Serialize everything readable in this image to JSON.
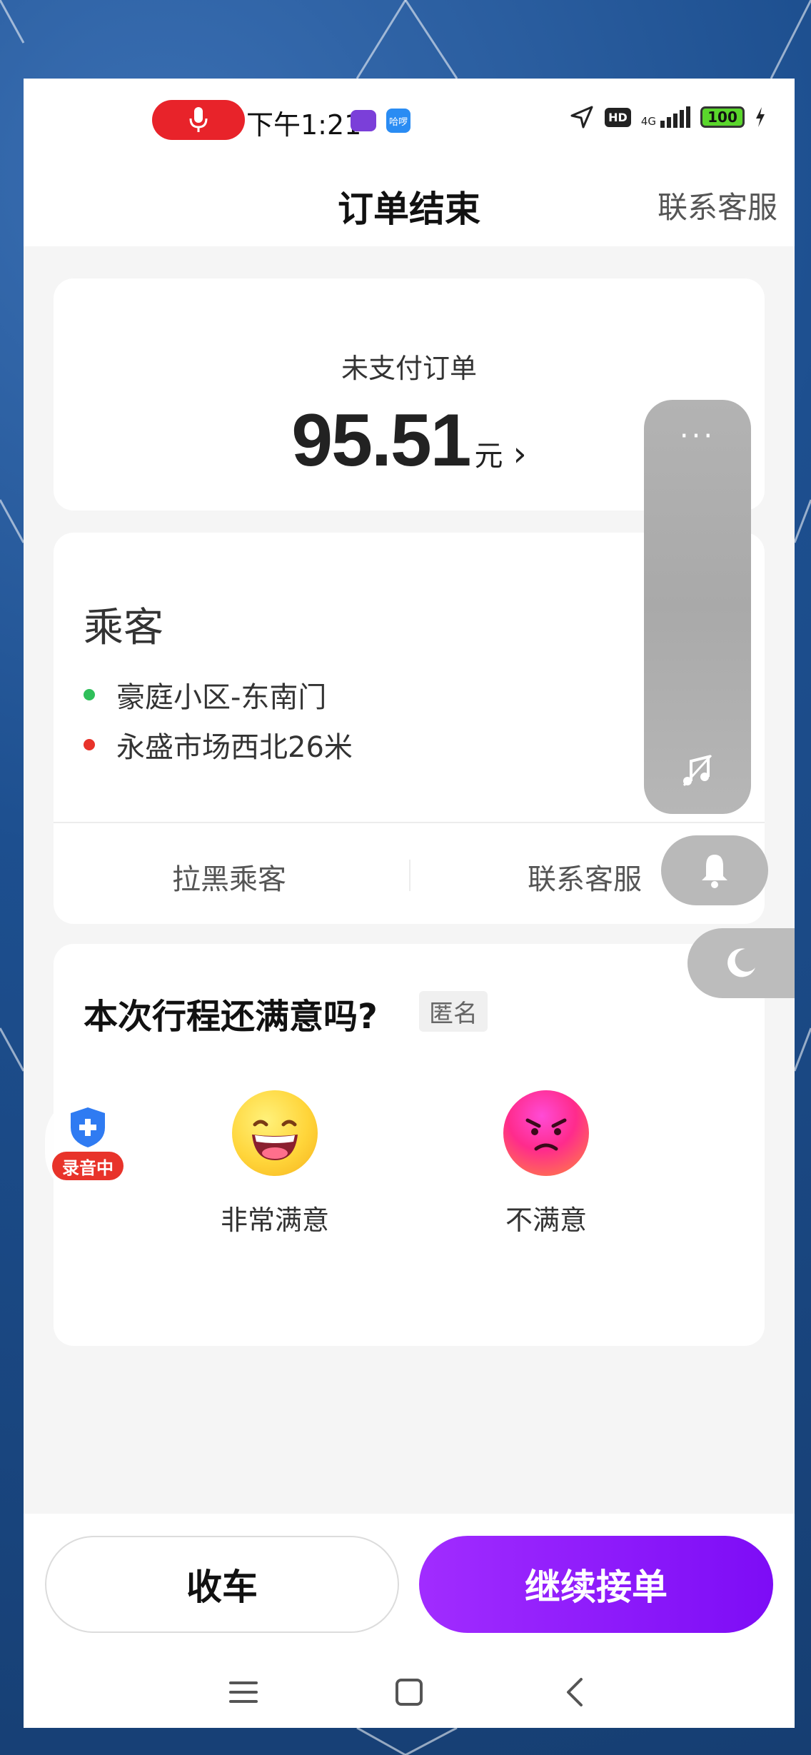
{
  "status_bar": {
    "time": "下午1:21",
    "app2_label": "哈啰",
    "hd": "HD",
    "network": "4G",
    "battery": "100"
  },
  "header": {
    "title": "订单结束",
    "contact_label": "联系客服"
  },
  "payment": {
    "label": "未支付订单",
    "amount": "95.51",
    "unit": "元",
    "chevron": "›"
  },
  "passenger": {
    "title": "乘客",
    "pickup": "豪庭小区-东南门",
    "dropoff": "永盛市场西北26米",
    "block_label": "拉黑乘客",
    "contact_label": "联系客服",
    "pickup_color": "#2fbf5a",
    "dropoff_color": "#e8332a"
  },
  "rating": {
    "question": "本次行程还满意吗?",
    "anonymous_tag": "匿名",
    "options": [
      {
        "label": "非常满意",
        "icon": "happy-face-icon"
      },
      {
        "label": "不满意",
        "icon": "angry-face-icon"
      }
    ]
  },
  "floating": {
    "dots": "···",
    "recording_label": "录音中"
  },
  "actions": {
    "end_label": "收车",
    "continue_label": "继续接单",
    "accent": "#8a1cfb"
  },
  "navbar": {
    "icons": [
      "menu-icon",
      "home-square-icon",
      "back-chevron-icon"
    ]
  }
}
